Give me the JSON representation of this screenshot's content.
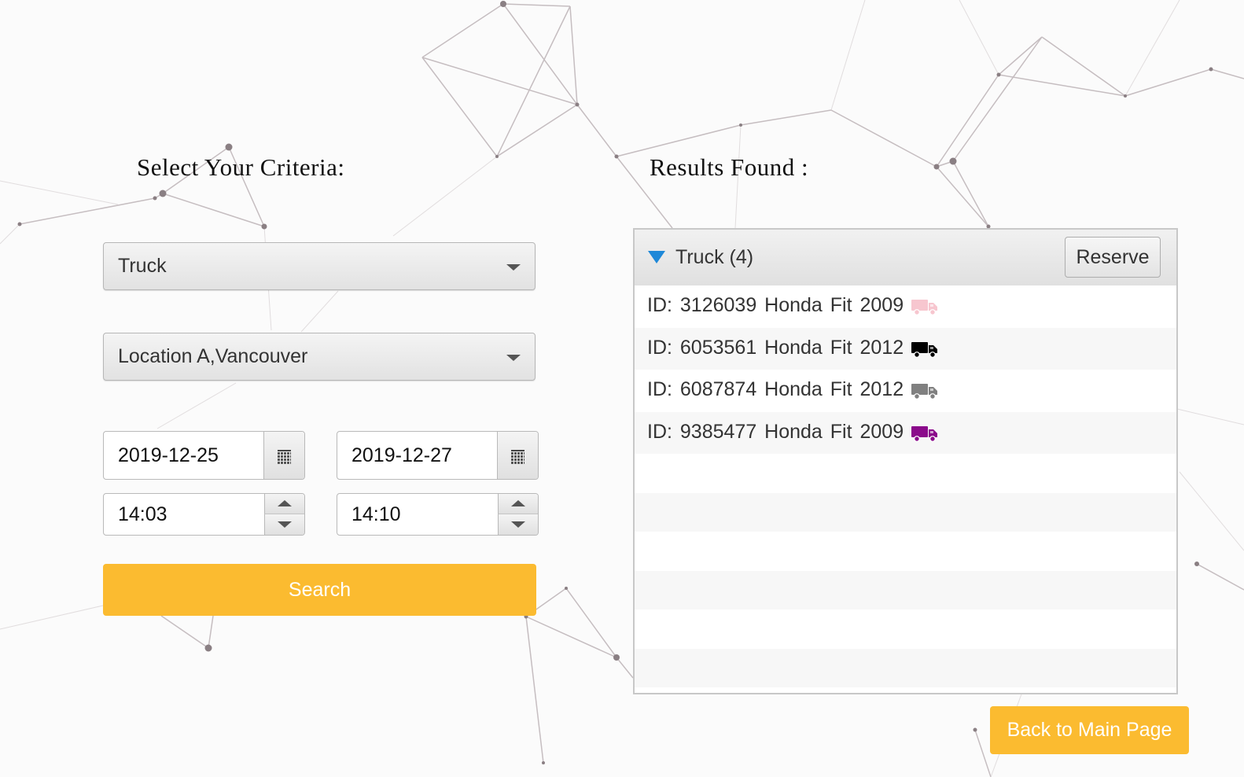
{
  "criteria_heading": "Select Your Criteria:",
  "results_heading": "Results Found :",
  "vehicle_type": {
    "selected": "Truck"
  },
  "location": {
    "selected": "Location A,Vancouver"
  },
  "start": {
    "date": "2019-12-25",
    "time": "14:03"
  },
  "end": {
    "date": "2019-12-27",
    "time": "14:10"
  },
  "search_button": "Search",
  "back_button": "Back to Main Page",
  "results": {
    "group_label": "Truck (4)",
    "reserve_button": "Reserve",
    "items": [
      {
        "label": "ID: 3126039  Honda  Fit  2009",
        "icon": "truck-icon",
        "color": "#f7c6cf"
      },
      {
        "label": "ID: 6053561  Honda  Fit  2012",
        "icon": "truck-icon",
        "color": "#000000"
      },
      {
        "label": "ID: 6087874  Honda  Fit  2012",
        "icon": "truck-icon",
        "color": "#808080"
      },
      {
        "label": "ID: 9385477  Honda  Fit  2009",
        "icon": "truck-icon",
        "color": "#8b0a8b"
      }
    ]
  },
  "colors": {
    "accent": "#fbbb30",
    "disclosure": "#1e88d8"
  }
}
